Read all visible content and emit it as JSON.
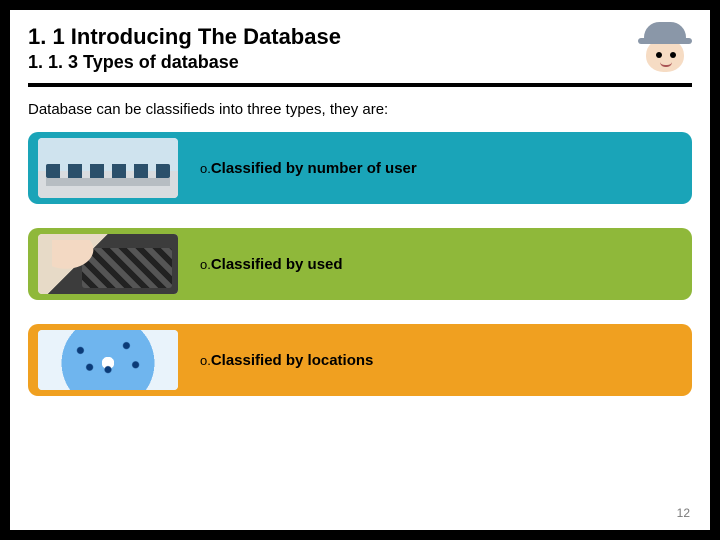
{
  "header": {
    "section_title": "1. 1 Introducing The Database",
    "subsection_title": "1. 1. 3 Types of database"
  },
  "intro_text": "Database can be classifieds into three types, they are:",
  "items": [
    {
      "bullet": "o.",
      "label": "Classified by number of user",
      "color": "#1aa4b8",
      "thumb": "computer-lab"
    },
    {
      "bullet": "o.",
      "label": "Classified by used",
      "color": "#8fb83a",
      "thumb": "keyboard"
    },
    {
      "bullet": "o.",
      "label": "Classified by locations",
      "color": "#f0a020",
      "thumb": "network-globe"
    }
  ],
  "avatar_name": "mascot-avatar",
  "page_number": "12"
}
